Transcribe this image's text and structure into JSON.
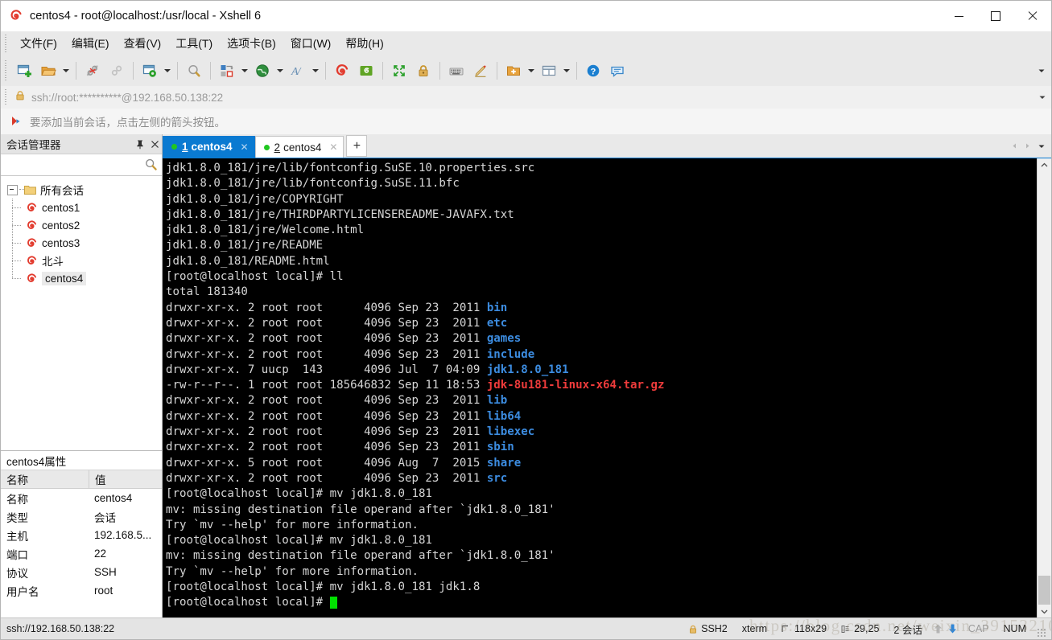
{
  "window": {
    "title": "centos4 - root@localhost:/usr/local - Xshell 6",
    "app_icon": "xshell-icon",
    "minimize": "─",
    "maximize": "□",
    "close": "✕"
  },
  "menu": {
    "items": [
      {
        "label": "文件(F)",
        "name": "menu-file"
      },
      {
        "label": "编辑(E)",
        "name": "menu-edit"
      },
      {
        "label": "查看(V)",
        "name": "menu-view"
      },
      {
        "label": "工具(T)",
        "name": "menu-tools"
      },
      {
        "label": "选项卡(B)",
        "name": "menu-tabs"
      },
      {
        "label": "窗口(W)",
        "name": "menu-window"
      },
      {
        "label": "帮助(H)",
        "name": "menu-help"
      }
    ]
  },
  "toolbar": {
    "icons": [
      "new-session-icon",
      "open-folder-icon",
      "disconnect-icon",
      "reconnect-icon",
      "session-properties-icon",
      "find-icon",
      "transfer-icon",
      "globe-icon",
      "font-icon",
      "xshell-icon",
      "xftp-icon",
      "fullscreen-icon",
      "lock-icon",
      "keyboard-icon",
      "highlight-icon",
      "new-folder-icon",
      "layout-icon",
      "help-icon",
      "feedback-icon"
    ],
    "overflow": "▾"
  },
  "address": {
    "lock_icon": "lock-icon",
    "url": "ssh://root:**********@192.168.50.138:22",
    "dropdown": "▾"
  },
  "notice": {
    "icon": "bookmark-arrow-icon",
    "text": "要添加当前会话，点击左侧的箭头按钮。"
  },
  "session_manager": {
    "title": "会话管理器",
    "pin_icon": "pin-icon",
    "close_icon": "close-icon",
    "search_placeholder": "",
    "search_value": "",
    "search_icon": "search-icon",
    "root_label": "所有会话",
    "sessions": [
      {
        "label": "centos1",
        "selected": false
      },
      {
        "label": "centos2",
        "selected": false
      },
      {
        "label": "centos3",
        "selected": false
      },
      {
        "label": "北斗",
        "selected": false
      },
      {
        "label": "centos4",
        "selected": true
      }
    ]
  },
  "properties": {
    "title": "centos4属性",
    "headers": [
      "名称",
      "值"
    ],
    "rows": [
      [
        "名称",
        "centos4"
      ],
      [
        "类型",
        "会话"
      ],
      [
        "主机",
        "192.168.5..."
      ],
      [
        "端口",
        "22"
      ],
      [
        "协议",
        "SSH"
      ],
      [
        "用户名",
        "root"
      ]
    ]
  },
  "tabs": {
    "items": [
      {
        "num": "1",
        "label": "centos4",
        "active": true,
        "status": "connected"
      },
      {
        "num": "2",
        "label": "centos4",
        "active": false,
        "status": "connected"
      }
    ],
    "new_tab": "+",
    "scroll_left": "◂",
    "scroll_right": "▸",
    "tab_list": "▾"
  },
  "terminal": {
    "scroll_up": "⌃",
    "scroll_down": "⌄",
    "lines": [
      [
        {
          "t": "jdk1.8.0_181/jre/lib/fontconfig.SuSE.10.properties.src"
        }
      ],
      [
        {
          "t": "jdk1.8.0_181/jre/lib/fontconfig.SuSE.11.bfc"
        }
      ],
      [
        {
          "t": "jdk1.8.0_181/jre/COPYRIGHT"
        }
      ],
      [
        {
          "t": "jdk1.8.0_181/jre/THIRDPARTYLICENSEREADME-JAVAFX.txt"
        }
      ],
      [
        {
          "t": "jdk1.8.0_181/jre/Welcome.html"
        }
      ],
      [
        {
          "t": "jdk1.8.0_181/jre/README"
        }
      ],
      [
        {
          "t": "jdk1.8.0_181/README.html"
        }
      ],
      [
        {
          "t": "[root@localhost local]# ll"
        }
      ],
      [
        {
          "t": "total 181340"
        }
      ],
      [
        {
          "t": "drwxr-xr-x. 2 root root      4096 Sep 23  2011 "
        },
        {
          "t": "bin",
          "c": "blue"
        }
      ],
      [
        {
          "t": "drwxr-xr-x. 2 root root      4096 Sep 23  2011 "
        },
        {
          "t": "etc",
          "c": "blue"
        }
      ],
      [
        {
          "t": "drwxr-xr-x. 2 root root      4096 Sep 23  2011 "
        },
        {
          "t": "games",
          "c": "blue"
        }
      ],
      [
        {
          "t": "drwxr-xr-x. 2 root root      4096 Sep 23  2011 "
        },
        {
          "t": "include",
          "c": "blue"
        }
      ],
      [
        {
          "t": "drwxr-xr-x. 7 uucp  143      4096 Jul  7 04:09 "
        },
        {
          "t": "jdk1.8.0_181",
          "c": "blue"
        }
      ],
      [
        {
          "t": "-rw-r--r--. 1 root root 185646832 Sep 11 18:53 "
        },
        {
          "t": "jdk-8u181-linux-x64.tar.gz",
          "c": "red"
        }
      ],
      [
        {
          "t": "drwxr-xr-x. 2 root root      4096 Sep 23  2011 "
        },
        {
          "t": "lib",
          "c": "blue"
        }
      ],
      [
        {
          "t": "drwxr-xr-x. 2 root root      4096 Sep 23  2011 "
        },
        {
          "t": "lib64",
          "c": "blue"
        }
      ],
      [
        {
          "t": "drwxr-xr-x. 2 root root      4096 Sep 23  2011 "
        },
        {
          "t": "libexec",
          "c": "blue"
        }
      ],
      [
        {
          "t": "drwxr-xr-x. 2 root root      4096 Sep 23  2011 "
        },
        {
          "t": "sbin",
          "c": "blue"
        }
      ],
      [
        {
          "t": "drwxr-xr-x. 5 root root      4096 Aug  7  2015 "
        },
        {
          "t": "share",
          "c": "blue"
        }
      ],
      [
        {
          "t": "drwxr-xr-x. 2 root root      4096 Sep 23  2011 "
        },
        {
          "t": "src",
          "c": "blue"
        }
      ],
      [
        {
          "t": "[root@localhost local]# mv jdk1.8.0_181"
        }
      ],
      [
        {
          "t": "mv: missing destination file operand after `jdk1.8.0_181'"
        }
      ],
      [
        {
          "t": "Try `mv --help' for more information."
        }
      ],
      [
        {
          "t": "[root@localhost local]# mv jdk1.8.0_181"
        }
      ],
      [
        {
          "t": "mv: missing destination file operand after `jdk1.8.0_181'"
        }
      ],
      [
        {
          "t": "Try `mv --help' for more information."
        }
      ],
      [
        {
          "t": "[root@localhost local]# mv jdk1.8.0_181 jdk1.8"
        }
      ],
      [
        {
          "t": "[root@localhost local]# ",
          "cursor": true
        }
      ]
    ]
  },
  "statusbar": {
    "left": "ssh://192.168.50.138:22",
    "lock_icon": "lock-icon",
    "protocol": "SSH2",
    "terminal_type": "xterm",
    "size_icon": "size-icon",
    "size": "118x29",
    "cursor_icon": "cursor-pos-icon",
    "cursor_pos": "29,25",
    "sessions": "2 会话",
    "upload_icon": "upload-arrow-icon",
    "download_icon": "download-arrow-icon",
    "cap": "CAP",
    "num": "NUM"
  },
  "watermark": {
    "text": "https://blog.csdn.net/weixin_39153210"
  },
  "colors": {
    "accent": "#0a7ad1",
    "terminal_bg": "#000000",
    "terminal_fg": "#d6d6d6",
    "dir_blue": "#3c8ce0",
    "archive_red": "#ee3b3b",
    "cursor_green": "#00e000",
    "chrome_bg": "#e9e9e9"
  }
}
